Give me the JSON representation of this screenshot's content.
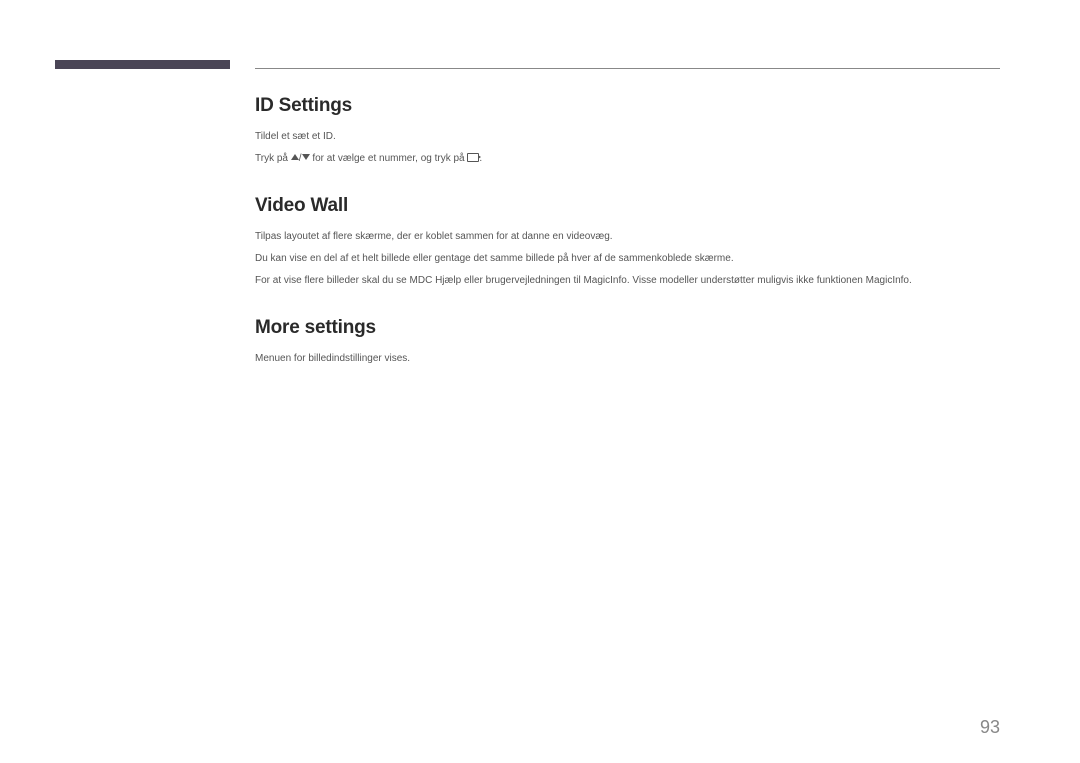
{
  "sections": {
    "idSettings": {
      "heading": "ID Settings",
      "line1": "Tildel et sæt et ID.",
      "line2a": "Tryk på ",
      "line2b": " for at vælge et nummer, og tryk på ",
      "line2c": "."
    },
    "videoWall": {
      "heading": "Video Wall",
      "line1": "Tilpas layoutet af flere skærme, der er koblet sammen for at danne en videovæg.",
      "line2": "Du kan vise en del af et helt billede eller gentage det samme billede på hver af de sammenkoblede skærme.",
      "line3": "For at vise flere billeder skal du se MDC Hjælp eller brugervejledningen til MagicInfo. Visse modeller understøtter muligvis ikke funktionen MagicInfo."
    },
    "moreSettings": {
      "heading": "More settings",
      "line1": "Menuen for billedindstillinger vises."
    }
  },
  "icons": {
    "upDownSeparator": "/"
  },
  "pageNumber": "93"
}
